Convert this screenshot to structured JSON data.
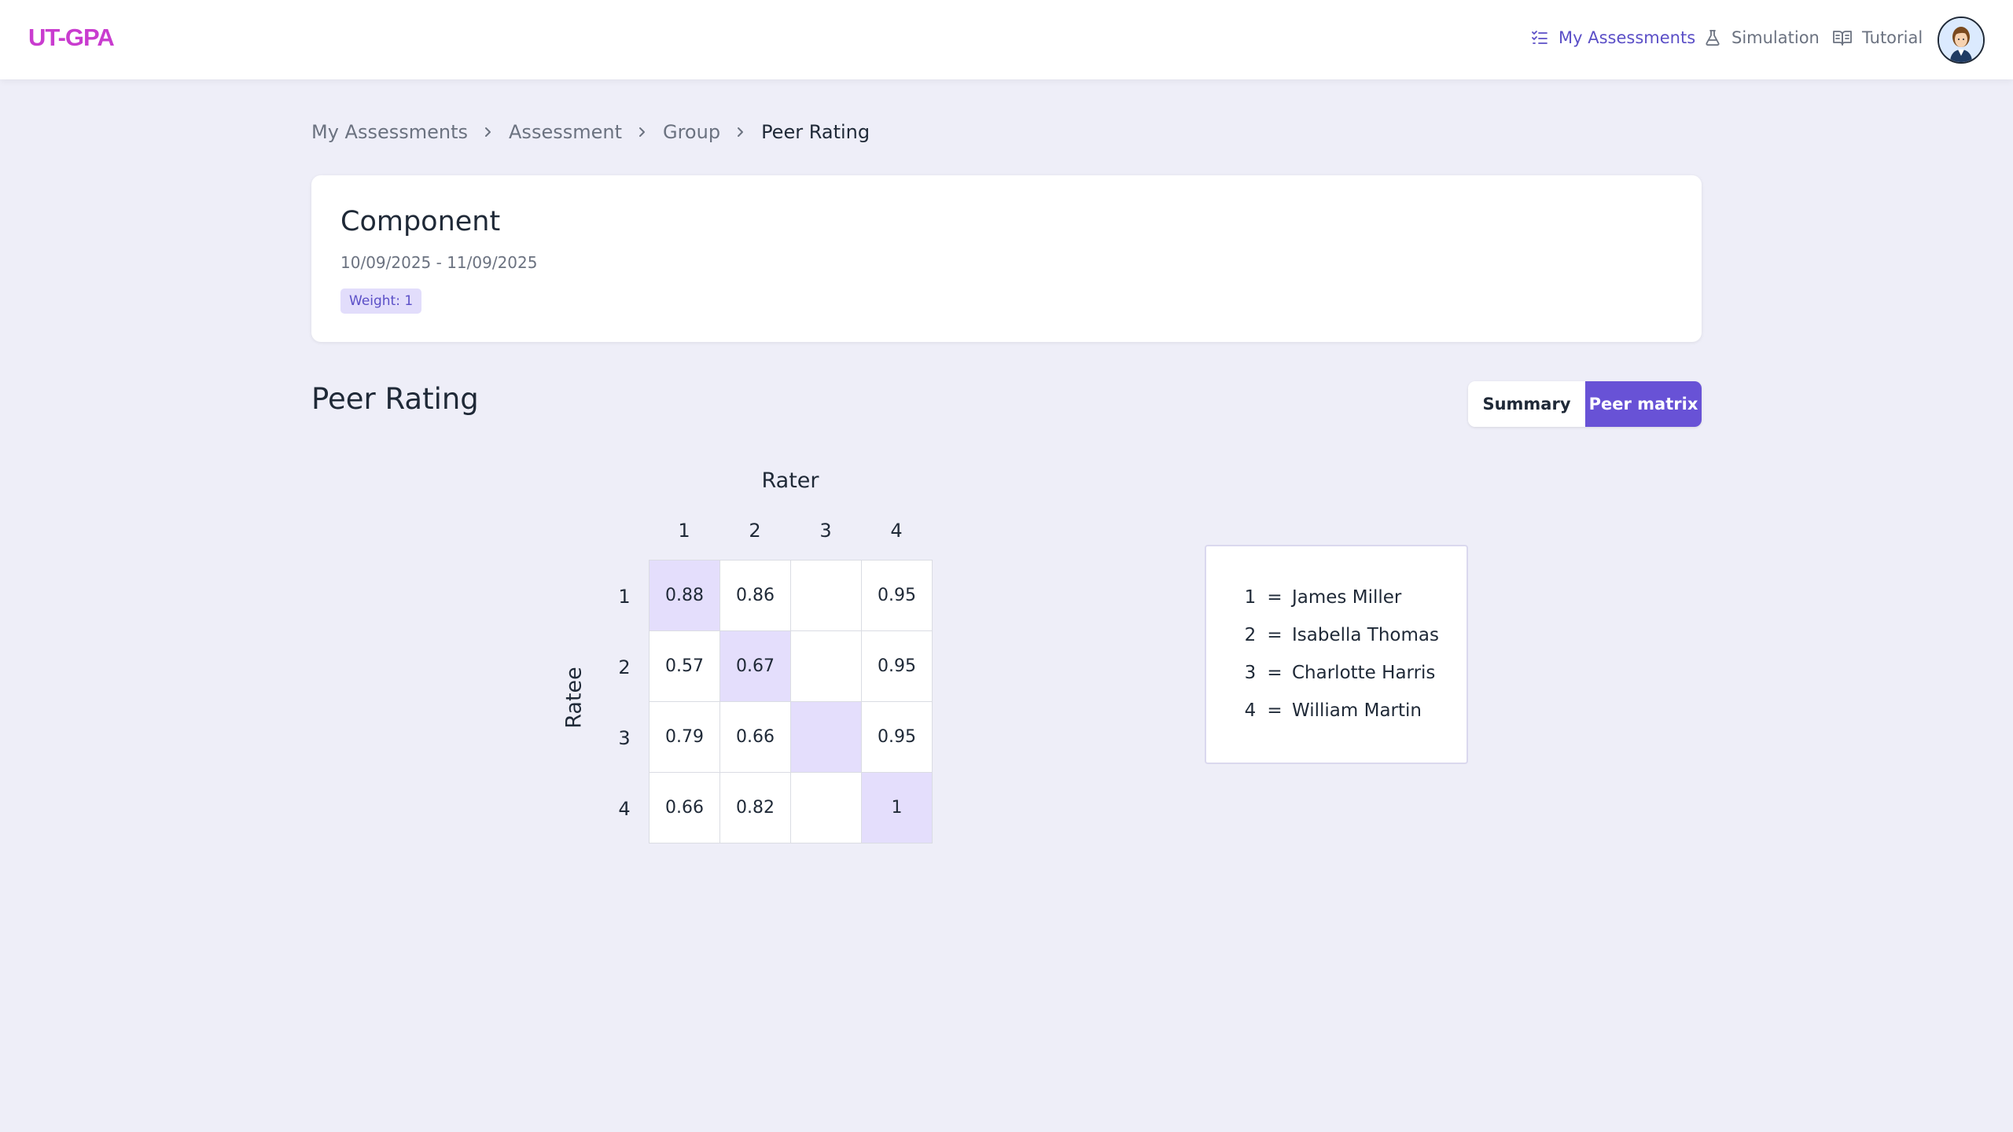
{
  "app": {
    "brand": "UT-GPA"
  },
  "nav": {
    "my_assessments": "My Assessments",
    "simulation": "Simulation",
    "tutorial": "Tutorial"
  },
  "breadcrumb": [
    "My Assessments",
    "Assessment",
    "Group",
    "Peer Rating"
  ],
  "component": {
    "title": "Component",
    "dates": "10/09/2025 - 11/09/2025",
    "weight_badge": "Weight: 1"
  },
  "peer_rating": {
    "title": "Peer Rating",
    "toggle": {
      "summary": "Summary",
      "peer_matrix": "Peer matrix",
      "active": "Peer matrix"
    },
    "matrix": {
      "rater_label": "Rater",
      "ratee_label": "Ratee",
      "columns": [
        "1",
        "2",
        "3",
        "4"
      ],
      "rows": [
        "1",
        "2",
        "3",
        "4"
      ],
      "values": [
        [
          "0.88",
          "0.86",
          "",
          "0.95"
        ],
        [
          "0.57",
          "0.67",
          "",
          "0.95"
        ],
        [
          "0.79",
          "0.66",
          "",
          "0.95"
        ],
        [
          "0.66",
          "0.82",
          "",
          "1"
        ]
      ]
    },
    "legend": [
      {
        "num": "1",
        "eq": "=",
        "name": "James Miller"
      },
      {
        "num": "2",
        "eq": "=",
        "name": "Isabella Thomas"
      },
      {
        "num": "3",
        "eq": "=",
        "name": "Charlotte Harris"
      },
      {
        "num": "4",
        "eq": "=",
        "name": "William Martin"
      }
    ]
  },
  "colors": {
    "brand": "#c93ccf",
    "accent": "#6852d6",
    "diagonal_highlight": "#e4defc",
    "page_background": "#eeeef8"
  },
  "icons": {
    "my_assessments": "checklist-icon",
    "simulation": "flask-icon",
    "tutorial": "book-icon",
    "breadcrumb_separator": "chevron-right-icon",
    "avatar": "user-avatar"
  }
}
